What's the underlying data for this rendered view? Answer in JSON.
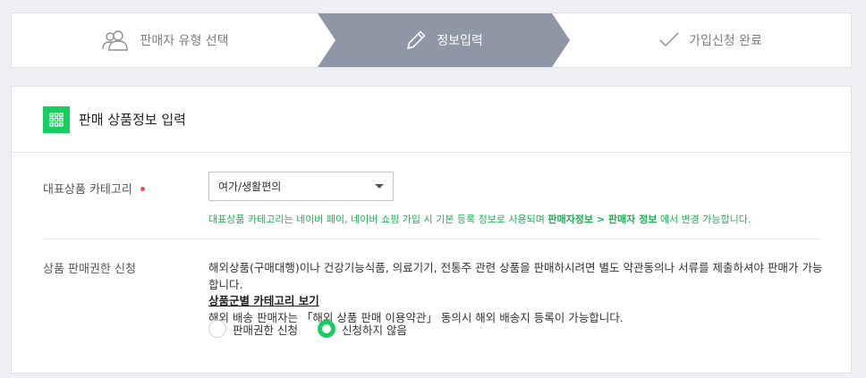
{
  "stepper": {
    "steps": [
      {
        "label": "판매자 유형 선택",
        "icon": "users-icon",
        "state": "done"
      },
      {
        "label": "정보입력",
        "icon": "pencil-icon",
        "state": "active"
      },
      {
        "label": "가입신청 완료",
        "icon": "check-icon",
        "state": "pending"
      }
    ]
  },
  "section": {
    "title": "판매 상품정보 입력",
    "icon": "grid-icon",
    "accent_color": "#19ce60"
  },
  "category": {
    "label": "대표상품 카테고리",
    "required": true,
    "selected": "여가/생활편의",
    "helper_prefix": "대표상품 카테고리는 네이버 페이, 네이버 쇼핑 가입 시 기본 등록 정보로 사용되며 ",
    "helper_bold": "판매자정보 > 판매자 정보",
    "helper_suffix": " 에서 변경 가능합니다."
  },
  "permission": {
    "label": "상품 판매권한 신청",
    "desc_line1": "해외상품(구매대행)이나 건강기능식품, 의료기기, 전통주 관련 상품을 판매하시려면 별도 약관동의나 서류를 제출하셔야 판매가 가능합니다.",
    "desc_link": "상품군별 카테고리 보기",
    "desc_line2": "해외 배송 판매자는 「해외 상품 판매 이용약관」 동의시 해외 배송지 등록이 가능합니다.",
    "options": [
      {
        "label": "판매권한 신청",
        "checked": false
      },
      {
        "label": "신청하지 않음",
        "checked": true
      }
    ]
  }
}
